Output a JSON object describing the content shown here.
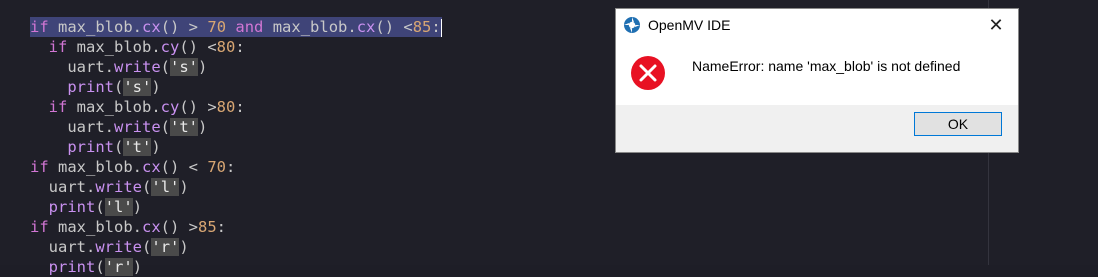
{
  "editor": {
    "lines": [
      {
        "indent": "",
        "selected": true,
        "tokens": [
          {
            "t": "if",
            "c": "kw"
          },
          {
            "t": " ",
            "c": "punc"
          },
          {
            "t": "max_blob.",
            "c": "fn"
          },
          {
            "t": "cx",
            "c": "meth"
          },
          {
            "t": "() > ",
            "c": "punc"
          },
          {
            "t": "70",
            "c": "num"
          },
          {
            "t": " ",
            "c": "punc"
          },
          {
            "t": "and",
            "c": "kw"
          },
          {
            "t": " max_blob.",
            "c": "fn"
          },
          {
            "t": "cx",
            "c": "meth"
          },
          {
            "t": "() <",
            "c": "punc"
          },
          {
            "t": "85",
            "c": "num"
          },
          {
            "t": ":",
            "c": "punc"
          }
        ]
      },
      {
        "indent": "  ",
        "tokens": [
          {
            "t": "if",
            "c": "kw"
          },
          {
            "t": " max_blob.",
            "c": "fn"
          },
          {
            "t": "cy",
            "c": "meth"
          },
          {
            "t": "() <",
            "c": "punc"
          },
          {
            "t": "80",
            "c": "num"
          },
          {
            "t": ":",
            "c": "punc"
          }
        ]
      },
      {
        "indent": "    ",
        "tokens": [
          {
            "t": "uart.",
            "c": "fn"
          },
          {
            "t": "write",
            "c": "meth"
          },
          {
            "t": "(",
            "c": "punc"
          },
          {
            "t": "'s'",
            "c": "str"
          },
          {
            "t": ")",
            "c": "punc"
          }
        ]
      },
      {
        "indent": "    ",
        "tokens": [
          {
            "t": "print",
            "c": "meth"
          },
          {
            "t": "(",
            "c": "punc"
          },
          {
            "t": "'s'",
            "c": "str"
          },
          {
            "t": ")",
            "c": "punc"
          }
        ]
      },
      {
        "indent": "  ",
        "tokens": [
          {
            "t": "if",
            "c": "kw"
          },
          {
            "t": " max_blob.",
            "c": "fn"
          },
          {
            "t": "cy",
            "c": "meth"
          },
          {
            "t": "() >",
            "c": "punc"
          },
          {
            "t": "80",
            "c": "num"
          },
          {
            "t": ":",
            "c": "punc"
          }
        ]
      },
      {
        "indent": "    ",
        "tokens": [
          {
            "t": "uart.",
            "c": "fn"
          },
          {
            "t": "write",
            "c": "meth"
          },
          {
            "t": "(",
            "c": "punc"
          },
          {
            "t": "'t'",
            "c": "str"
          },
          {
            "t": ")",
            "c": "punc"
          }
        ]
      },
      {
        "indent": "    ",
        "tokens": [
          {
            "t": "print",
            "c": "meth"
          },
          {
            "t": "(",
            "c": "punc"
          },
          {
            "t": "'t'",
            "c": "str"
          },
          {
            "t": ")",
            "c": "punc"
          }
        ]
      },
      {
        "indent": "",
        "tokens": [
          {
            "t": "if",
            "c": "kw"
          },
          {
            "t": " max_blob.",
            "c": "fn"
          },
          {
            "t": "cx",
            "c": "meth"
          },
          {
            "t": "() < ",
            "c": "punc"
          },
          {
            "t": "70",
            "c": "num"
          },
          {
            "t": ":",
            "c": "punc"
          }
        ]
      },
      {
        "indent": "  ",
        "tokens": [
          {
            "t": "uart.",
            "c": "fn"
          },
          {
            "t": "write",
            "c": "meth"
          },
          {
            "t": "(",
            "c": "punc"
          },
          {
            "t": "'l'",
            "c": "str"
          },
          {
            "t": ")",
            "c": "punc"
          }
        ]
      },
      {
        "indent": "  ",
        "tokens": [
          {
            "t": "print",
            "c": "meth"
          },
          {
            "t": "(",
            "c": "punc"
          },
          {
            "t": "'l'",
            "c": "str"
          },
          {
            "t": ")",
            "c": "punc"
          }
        ]
      },
      {
        "indent": "",
        "tokens": [
          {
            "t": "if",
            "c": "kw"
          },
          {
            "t": " max_blob.",
            "c": "fn"
          },
          {
            "t": "cx",
            "c": "meth"
          },
          {
            "t": "() >",
            "c": "punc"
          },
          {
            "t": "85",
            "c": "num"
          },
          {
            "t": ":",
            "c": "punc"
          }
        ]
      },
      {
        "indent": "  ",
        "tokens": [
          {
            "t": "uart.",
            "c": "fn"
          },
          {
            "t": "write",
            "c": "meth"
          },
          {
            "t": "(",
            "c": "punc"
          },
          {
            "t": "'r'",
            "c": "str"
          },
          {
            "t": ")",
            "c": "punc"
          }
        ]
      },
      {
        "indent": "  ",
        "tokens": [
          {
            "t": "print",
            "c": "meth"
          },
          {
            "t": "(",
            "c": "punc"
          },
          {
            "t": "'r'",
            "c": "str"
          },
          {
            "t": ")",
            "c": "punc"
          }
        ]
      }
    ]
  },
  "dialog": {
    "title": "OpenMV IDE",
    "message": "NameError: name 'max_blob' is not defined",
    "ok_label": "OK",
    "close_glyph": "✕",
    "error_icon": "error-icon",
    "app_icon": "openmv-icon"
  },
  "colors": {
    "editor_bg": "#1f1f28",
    "selection": "#3f4478",
    "keyword": "#d176d4",
    "method": "#c991f0",
    "number": "#d8a673",
    "error_red": "#e81123",
    "button_border": "#0078d7"
  }
}
